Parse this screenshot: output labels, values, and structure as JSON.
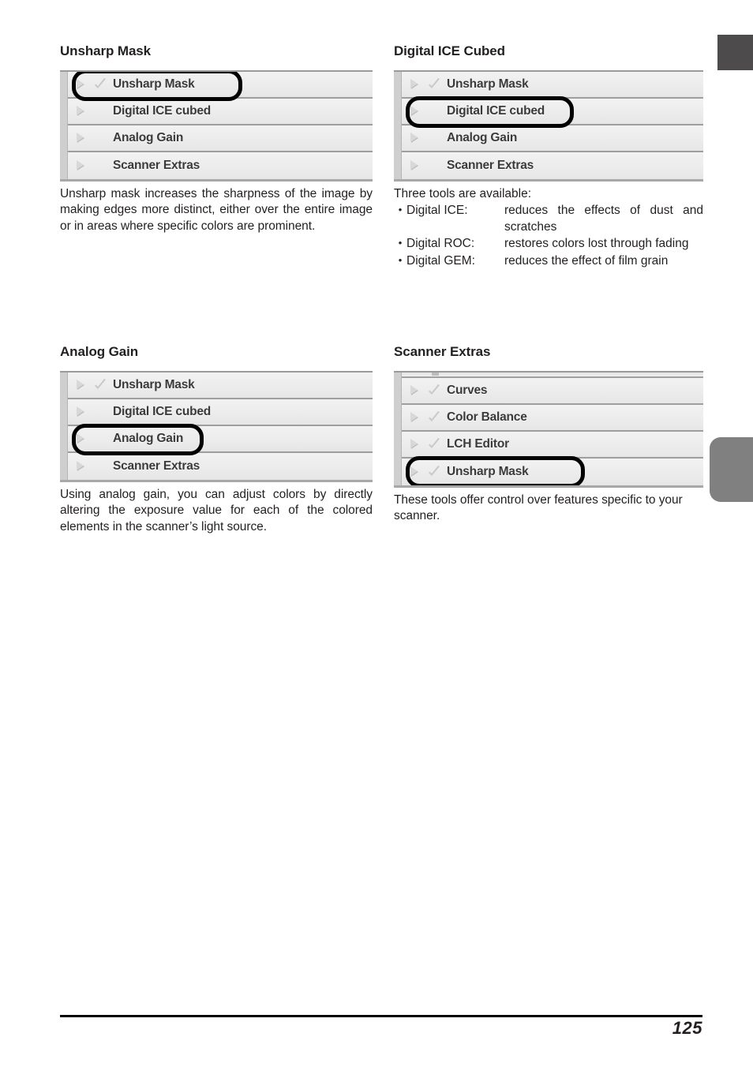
{
  "page": {
    "number": "125"
  },
  "edge_tabs": [
    {
      "name": "top-dark-tab",
      "color": "#4d4b4c"
    },
    {
      "name": "middle-gray-tab",
      "color": "#808080"
    }
  ],
  "sections": [
    {
      "id": "unsharp-mask",
      "heading": "Unsharp Mask",
      "panel": {
        "clipped_top": false,
        "rows": [
          {
            "label": "Unsharp Mask",
            "checked": true,
            "highlighted": true,
            "ring_width": 216
          },
          {
            "label": "Digital ICE cubed",
            "checked": false,
            "highlighted": false
          },
          {
            "label": "Analog Gain",
            "checked": false,
            "highlighted": false
          },
          {
            "label": "Scanner Extras",
            "checked": false,
            "highlighted": false
          }
        ]
      },
      "body": "Unsharp mask increases the sharpness of the image by making edges more distinct, either over the entire image or in areas where specific colors are prominent."
    },
    {
      "id": "digital-ice-cubed",
      "heading": "Digital ICE Cubed",
      "panel": {
        "clipped_top": false,
        "rows": [
          {
            "label": "Unsharp Mask",
            "checked": true,
            "highlighted": false
          },
          {
            "label": "Digital ICE cubed",
            "checked": false,
            "highlighted": true,
            "ring_width": 213
          },
          {
            "label": "Analog Gain",
            "checked": false,
            "highlighted": false
          },
          {
            "label": "Scanner Extras",
            "checked": false,
            "highlighted": false
          }
        ]
      },
      "intro": "Three tools are available:",
      "tools": [
        {
          "bullet": "•",
          "name": "Digital ICE:",
          "desc": "reduces the effects of dust and scratches",
          "justify": true
        },
        {
          "bullet": "•",
          "name": "Digital ROC:",
          "desc": "restores colors lost through fading",
          "justify": true
        },
        {
          "bullet": "•",
          "name": "Digital GEM:",
          "desc": "reduces the effect of film grain",
          "justify": false
        }
      ]
    },
    {
      "id": "analog-gain",
      "heading": "Analog Gain",
      "panel": {
        "clipped_top": false,
        "rows": [
          {
            "label": "Unsharp Mask",
            "checked": true,
            "highlighted": false
          },
          {
            "label": "Digital ICE cubed",
            "checked": false,
            "highlighted": false
          },
          {
            "label": "Analog Gain",
            "checked": false,
            "highlighted": true,
            "ring_width": 167
          },
          {
            "label": "Scanner Extras",
            "checked": false,
            "highlighted": false
          }
        ]
      },
      "body": "Using analog gain, you can adjust colors by directly altering the exposure value for each of the colored elements in the scanner’s light source."
    },
    {
      "id": "scanner-extras",
      "heading": "Scanner Extras",
      "panel": {
        "clipped_top": true,
        "rows": [
          {
            "label": "Curves",
            "checked": true,
            "highlighted": false
          },
          {
            "label": "Color Balance",
            "checked": true,
            "highlighted": false
          },
          {
            "label": "LCH Editor",
            "checked": true,
            "highlighted": false
          },
          {
            "label": "Unsharp Mask",
            "checked": true,
            "highlighted": true,
            "ring_width": 227
          }
        ]
      },
      "body": "These tools offer control over features specific to your scanner."
    }
  ],
  "icons": {
    "disclosure_arrow": "triangle-right-icon",
    "checkmark": "check-icon"
  },
  "colors": {
    "text": "#231f20",
    "row_background": "#ececec",
    "row_divider": "#9e9e9e",
    "highlight_ring": "#000000",
    "icon_gray": "#c9c9c9"
  }
}
